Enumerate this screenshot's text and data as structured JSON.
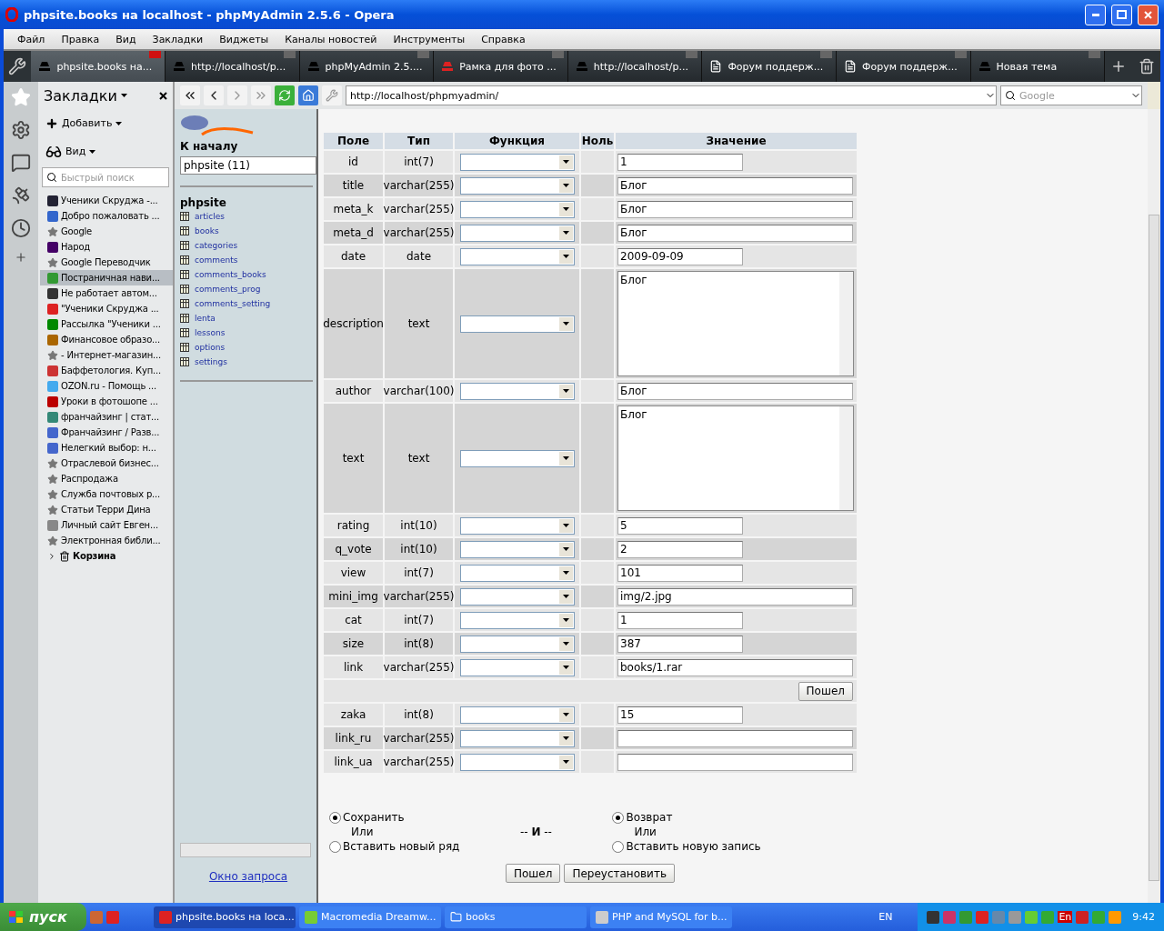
{
  "window": {
    "title": "phpsite.books на localhost - phpMyAdmin 2.5.6 - Opera"
  },
  "menu": [
    "Файл",
    "Правка",
    "Вид",
    "Закладки",
    "Виджеты",
    "Каналы новостей",
    "Инструменты",
    "Справка"
  ],
  "tabs": [
    {
      "label": "phpsite.books на...",
      "selected": true
    },
    {
      "label": "http://localhost/p...",
      "selected": false
    },
    {
      "label": "phpMyAdmin 2.5....",
      "selected": false
    },
    {
      "label": "Рамка для фото ...",
      "selected": false
    },
    {
      "label": "http://localhost/p...",
      "selected": false
    },
    {
      "label": "Форум поддерж...",
      "selected": false
    },
    {
      "label": "Форум поддерж...",
      "selected": false
    },
    {
      "label": "Новая тема",
      "selected": false
    }
  ],
  "bookmarks": {
    "title": "Закладки",
    "add": "Добавить",
    "view": "Вид",
    "search_placeholder": "Быстрый поиск",
    "items": [
      {
        "label": "Ученики Скруджа -...",
        "kind": "favicon",
        "selected": false
      },
      {
        "label": "Добро пожаловать ...",
        "kind": "favicon",
        "selected": false
      },
      {
        "label": "Google",
        "kind": "star",
        "selected": false
      },
      {
        "label": "Народ",
        "kind": "favicon",
        "selected": false
      },
      {
        "label": "Google Переводчик",
        "kind": "star",
        "selected": false
      },
      {
        "label": "Постраничная нави...",
        "kind": "favicon",
        "selected": true
      },
      {
        "label": "Не работает автом...",
        "kind": "favicon",
        "selected": false
      },
      {
        "label": "\"Ученики Скруджа ...",
        "kind": "favicon",
        "selected": false
      },
      {
        "label": "Рассылка \"Ученики ...",
        "kind": "favicon",
        "selected": false
      },
      {
        "label": "Финансовое образо...",
        "kind": "favicon",
        "selected": false
      },
      {
        "label": "- Интернет-магазин...",
        "kind": "star",
        "selected": false
      },
      {
        "label": "Баффетология. Куп...",
        "kind": "favicon",
        "selected": false
      },
      {
        "label": "OZON.ru - Помощь ...",
        "kind": "favicon",
        "selected": false
      },
      {
        "label": "Уроки в фотошопе ...",
        "kind": "favicon",
        "selected": false
      },
      {
        "label": "франчайзинг | стат...",
        "kind": "favicon",
        "selected": false
      },
      {
        "label": "Франчайзинг / Разв...",
        "kind": "favicon",
        "selected": false
      },
      {
        "label": "Нелегкий выбор: н...",
        "kind": "favicon",
        "selected": false
      },
      {
        "label": "Отраслевой бизнес...",
        "kind": "star",
        "selected": false
      },
      {
        "label": "Распродажа",
        "kind": "star",
        "selected": false
      },
      {
        "label": "Служба почтовых р...",
        "kind": "star",
        "selected": false
      },
      {
        "label": "Статьи Терри Дина",
        "kind": "star",
        "selected": false
      },
      {
        "label": "Личный сайт Евген...",
        "kind": "favicon",
        "selected": false
      },
      {
        "label": "Электронная библи...",
        "kind": "star",
        "selected": false
      }
    ],
    "trash": "Корзина"
  },
  "address": {
    "url": "http://localhost/phpmyadmin/",
    "search_placeholder": "Google"
  },
  "pma_nav": {
    "home": "К началу",
    "db_select": "phpsite (11)",
    "db_name": "phpsite",
    "tables": [
      "articles",
      "books",
      "categories",
      "comments",
      "comments_books",
      "comments_prog",
      "comments_setting",
      "lenta",
      "lessons",
      "options",
      "settings"
    ],
    "query_link": "Окно запроса"
  },
  "form": {
    "columns": [
      "Поле",
      "Тип",
      "Функция",
      "Ноль",
      "Значение"
    ],
    "rows": [
      {
        "kind": "short",
        "field": "id",
        "type": "int(7)",
        "value": "1"
      },
      {
        "kind": "wide",
        "field": "title",
        "type": "varchar(255)",
        "value": "Блог"
      },
      {
        "kind": "wide",
        "field": "meta_k",
        "type": "varchar(255)",
        "value": "Блог"
      },
      {
        "kind": "wide",
        "field": "meta_d",
        "type": "varchar(255)",
        "value": "Блог"
      },
      {
        "kind": "short",
        "field": "date",
        "type": "date",
        "value": "2009-09-09"
      },
      {
        "kind": "textarea",
        "field": "description",
        "type": "text",
        "value": "Блог"
      },
      {
        "kind": "wide",
        "field": "author",
        "type": "varchar(100)",
        "value": "Блог"
      },
      {
        "kind": "textarea",
        "field": "text",
        "type": "text",
        "value": "Блог"
      },
      {
        "kind": "short",
        "field": "rating",
        "type": "int(10)",
        "value": "5"
      },
      {
        "kind": "short",
        "field": "q_vote",
        "type": "int(10)",
        "value": "2"
      },
      {
        "kind": "short",
        "field": "view",
        "type": "int(7)",
        "value": "101"
      },
      {
        "kind": "wide",
        "field": "mini_img",
        "type": "varchar(255)",
        "value": "img/2.jpg"
      },
      {
        "kind": "short",
        "field": "cat",
        "type": "int(7)",
        "value": "1"
      },
      {
        "kind": "short",
        "field": "size",
        "type": "int(8)",
        "value": "387"
      },
      {
        "kind": "wide",
        "field": "link",
        "type": "varchar(255)",
        "value": "books/1.rar"
      },
      {
        "kind": "submit",
        "label": "Пошел"
      },
      {
        "kind": "short",
        "field": "zaka",
        "type": "int(8)",
        "value": "15"
      },
      {
        "kind": "wide",
        "field": "link_ru",
        "type": "varchar(255)"
      },
      {
        "kind": "wide",
        "field": "link_ua",
        "type": "varchar(255)"
      }
    ],
    "left_options": [
      {
        "label": "Сохранить",
        "selected": true
      },
      {
        "label": "Вставить новый ряд",
        "selected": false
      }
    ],
    "left_or": "Или",
    "joiner": "-- **И** --",
    "right_options": [
      {
        "label": "Возврат",
        "selected": true
      },
      {
        "label": "Вставить новую запись",
        "selected": false
      }
    ],
    "right_or": "Или",
    "buttons": [
      "Пошел",
      "Переустановить"
    ]
  },
  "taskbar": {
    "start": "пуск",
    "tasks": [
      {
        "label": "phpsite.books на loca...",
        "selected": true
      },
      {
        "label": "Macromedia Dreamw...",
        "selected": false
      },
      {
        "label": "books",
        "selected": false
      },
      {
        "label": "PHP and MySQL for b...",
        "selected": false
      }
    ],
    "lang": "EN",
    "tray_lang": "En",
    "clock": "9:42"
  }
}
